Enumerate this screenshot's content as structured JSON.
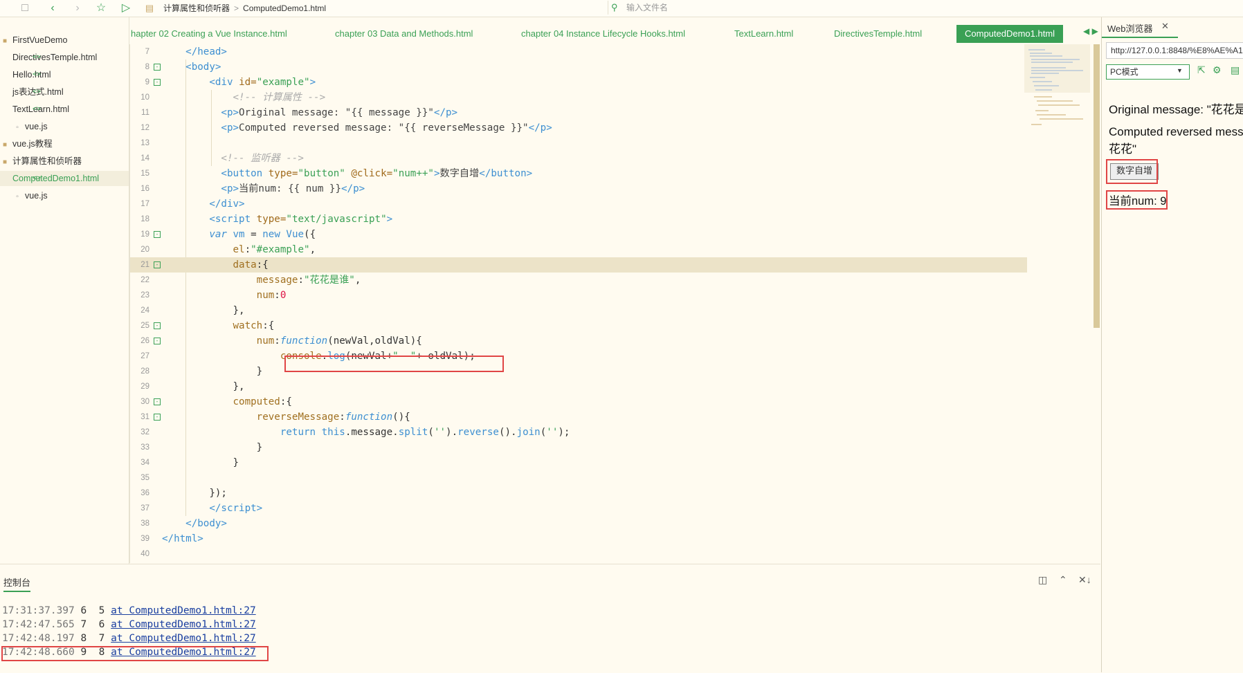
{
  "toolbar": {
    "breadcrumb": [
      "计算属性和侦听器",
      "ComputedDemo1.html"
    ],
    "search_placeholder": "输入文件名"
  },
  "sidebar": {
    "items": [
      {
        "label": "FirstVueDemo",
        "type": "folder"
      },
      {
        "label": "DirectivesTemple.html",
        "type": "code"
      },
      {
        "label": "Hello.html",
        "type": "code"
      },
      {
        "label": "js表达式.html",
        "type": "code"
      },
      {
        "label": "TextLearn.html",
        "type": "code"
      },
      {
        "label": "vue.js",
        "type": "file"
      },
      {
        "label": "vue.js教程",
        "type": "folder"
      },
      {
        "label": "计算属性和侦听器",
        "type": "folder"
      },
      {
        "label": "ComputedDemo1.html",
        "type": "code"
      },
      {
        "label": "vue.js",
        "type": "file"
      }
    ]
  },
  "tabs": [
    {
      "label": "hapter 02 Creating a Vue Instance.html"
    },
    {
      "label": "chapter 03 Data and Methods.html"
    },
    {
      "label": "chapter 04 Instance Lifecycle Hooks.html"
    },
    {
      "label": "TextLearn.html"
    },
    {
      "label": "DirectivesTemple.html"
    },
    {
      "label": "ComputedDemo1.html"
    }
  ],
  "editor": {
    "line_numbers": [
      "7",
      "8",
      "9",
      "10",
      "11",
      "12",
      "13",
      "14",
      "15",
      "16",
      "17",
      "18",
      "19",
      "20",
      "21",
      "22",
      "23",
      "24",
      "25",
      "26",
      "27",
      "28",
      "29",
      "30",
      "31",
      "32",
      "33",
      "34",
      "35",
      "36",
      "37",
      "38",
      "39",
      "40"
    ]
  },
  "console": {
    "tab_label": "控制台",
    "logs": [
      {
        "time": "17:31:37.397",
        "msg": " 6  5 ",
        "link": "at ComputedDemo1.html:27"
      },
      {
        "time": "17:42:47.565",
        "msg": " 7  6 ",
        "link": "at ComputedDemo1.html:27"
      },
      {
        "time": "17:42:48.197",
        "msg": " 8  7 ",
        "link": "at ComputedDemo1.html:27"
      },
      {
        "time": "17:42:48.660",
        "msg": " 9  8 ",
        "link": "at ComputedDemo1.html:27"
      }
    ]
  },
  "browser": {
    "tab_label": "Web浏览器",
    "url": "http://127.0.0.1:8848/%E8%AE%A1",
    "mode": "PC模式",
    "original_message": "Original message: \"花花是",
    "computed_line1": "Computed reversed mess",
    "computed_line2": "花花\"",
    "button_label": "数字自增",
    "num_text": "当前num: 9"
  },
  "colors": {
    "accent": "#3aa055",
    "highlight_box": "#e04545",
    "background": "#fffbf0"
  }
}
